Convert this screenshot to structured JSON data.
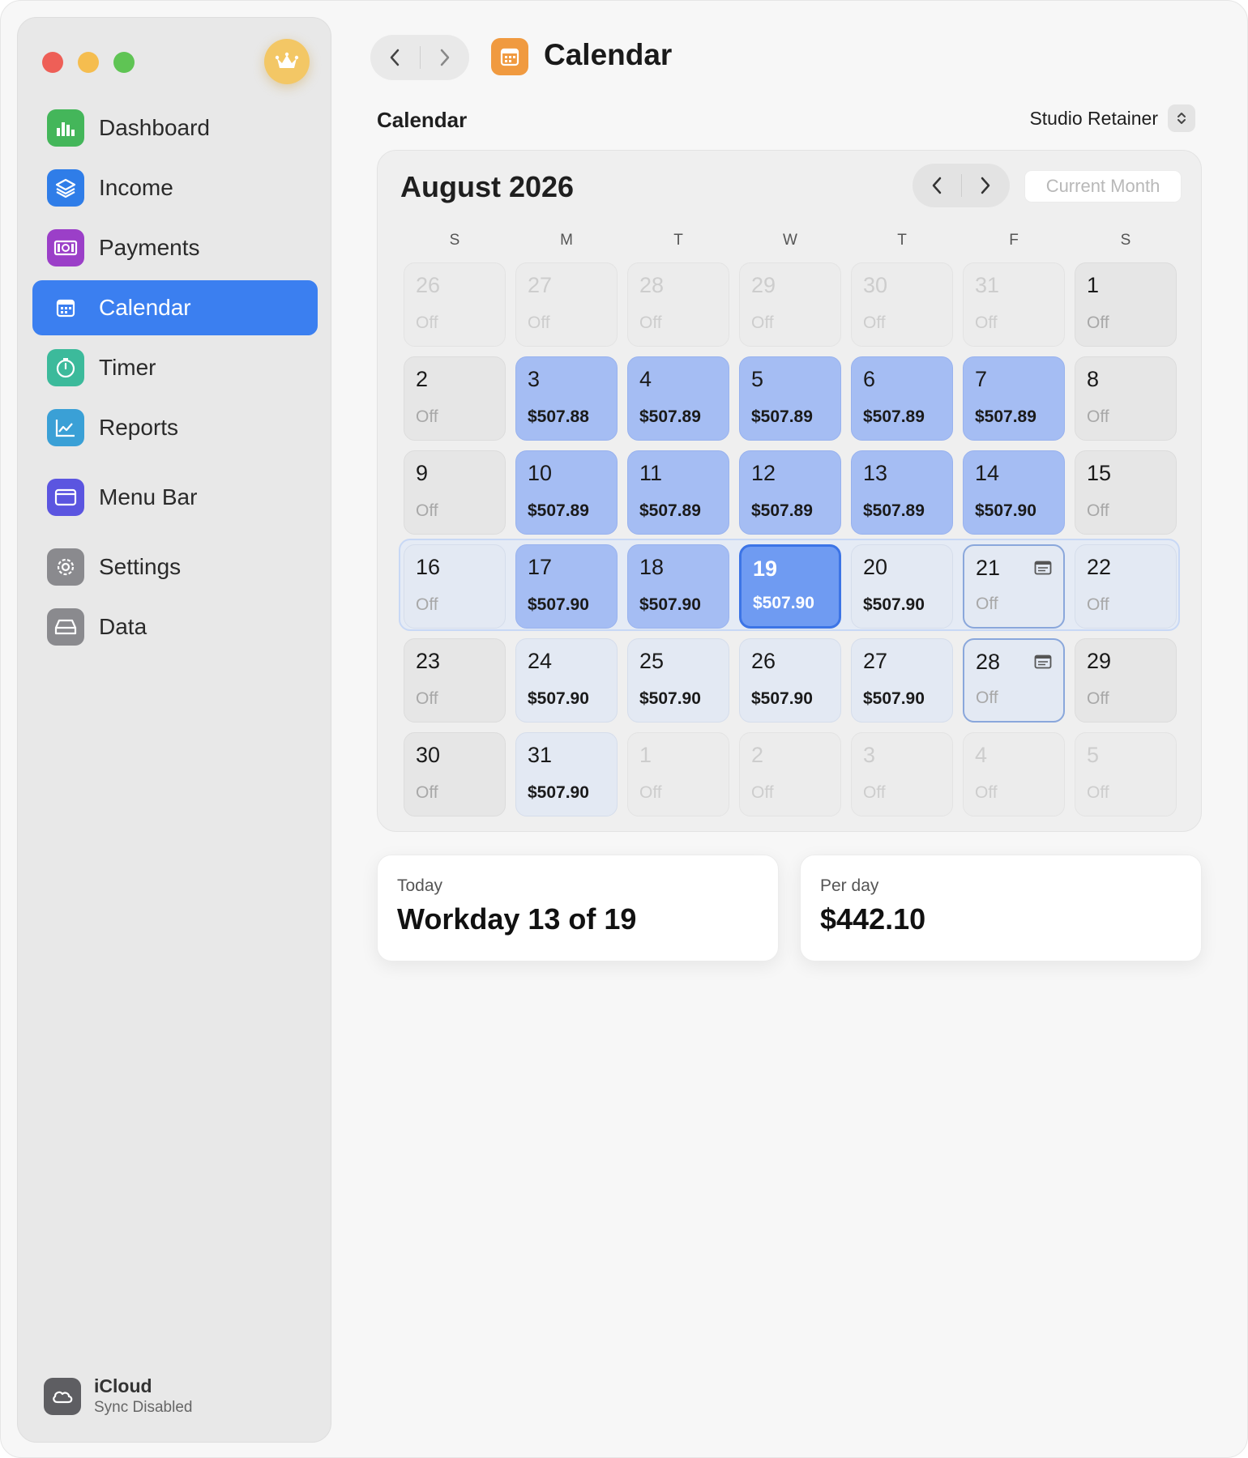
{
  "sidebar": {
    "items": [
      {
        "label": "Dashboard",
        "color": "#44b65a"
      },
      {
        "label": "Income",
        "color": "#2f7de8"
      },
      {
        "label": "Payments",
        "color": "#9b3fc8"
      },
      {
        "label": "Calendar",
        "color": "#3b7ff0"
      },
      {
        "label": "Timer",
        "color": "#3cba9b"
      },
      {
        "label": "Reports",
        "color": "#3aa0d6"
      },
      {
        "label": "Menu Bar",
        "color": "#5b55e0"
      },
      {
        "label": "Settings",
        "color": "#8a8a8e"
      },
      {
        "label": "Data",
        "color": "#8a8a8e"
      }
    ],
    "icloud": {
      "title": "iCloud",
      "status": "Sync Disabled"
    }
  },
  "header": {
    "title": "Calendar"
  },
  "section": {
    "title": "Calendar",
    "picker_value": "Studio Retainer"
  },
  "calendar": {
    "month_title": "August 2026",
    "current_month_button": "Current Month",
    "weekdays": [
      "S",
      "M",
      "T",
      "W",
      "T",
      "F",
      "S"
    ],
    "days": [
      {
        "day": "26",
        "amount": "Off",
        "state": "other"
      },
      {
        "day": "27",
        "amount": "Off",
        "state": "other"
      },
      {
        "day": "28",
        "amount": "Off",
        "state": "other"
      },
      {
        "day": "29",
        "amount": "Off",
        "state": "other"
      },
      {
        "day": "30",
        "amount": "Off",
        "state": "other"
      },
      {
        "day": "31",
        "amount": "Off",
        "state": "other"
      },
      {
        "day": "1",
        "amount": "Off",
        "state": "off"
      },
      {
        "day": "2",
        "amount": "Off",
        "state": "off"
      },
      {
        "day": "3",
        "amount": "$507.88",
        "state": "paid"
      },
      {
        "day": "4",
        "amount": "$507.89",
        "state": "paid"
      },
      {
        "day": "5",
        "amount": "$507.89",
        "state": "paid"
      },
      {
        "day": "6",
        "amount": "$507.89",
        "state": "paid"
      },
      {
        "day": "7",
        "amount": "$507.89",
        "state": "paid"
      },
      {
        "day": "8",
        "amount": "Off",
        "state": "off"
      },
      {
        "day": "9",
        "amount": "Off",
        "state": "off"
      },
      {
        "day": "10",
        "amount": "$507.89",
        "state": "paid"
      },
      {
        "day": "11",
        "amount": "$507.89",
        "state": "paid"
      },
      {
        "day": "12",
        "amount": "$507.89",
        "state": "paid"
      },
      {
        "day": "13",
        "amount": "$507.89",
        "state": "paid"
      },
      {
        "day": "14",
        "amount": "$507.90",
        "state": "paid"
      },
      {
        "day": "15",
        "amount": "Off",
        "state": "off"
      },
      {
        "day": "16",
        "amount": "Off",
        "state": "weekend-cur"
      },
      {
        "day": "17",
        "amount": "$507.90",
        "state": "paid"
      },
      {
        "day": "18",
        "amount": "$507.90",
        "state": "paid"
      },
      {
        "day": "19",
        "amount": "$507.90",
        "state": "today"
      },
      {
        "day": "20",
        "amount": "$507.90",
        "state": "future"
      },
      {
        "day": "21",
        "amount": "Off",
        "state": "outline",
        "note": true
      },
      {
        "day": "22",
        "amount": "Off",
        "state": "weekend-cur"
      },
      {
        "day": "23",
        "amount": "Off",
        "state": "off"
      },
      {
        "day": "24",
        "amount": "$507.90",
        "state": "future"
      },
      {
        "day": "25",
        "amount": "$507.90",
        "state": "future"
      },
      {
        "day": "26",
        "amount": "$507.90",
        "state": "future"
      },
      {
        "day": "27",
        "amount": "$507.90",
        "state": "future"
      },
      {
        "day": "28",
        "amount": "Off",
        "state": "outline",
        "note": true
      },
      {
        "day": "29",
        "amount": "Off",
        "state": "off"
      },
      {
        "day": "30",
        "amount": "Off",
        "state": "off"
      },
      {
        "day": "31",
        "amount": "$507.90",
        "state": "future"
      },
      {
        "day": "1",
        "amount": "Off",
        "state": "other"
      },
      {
        "day": "2",
        "amount": "Off",
        "state": "other"
      },
      {
        "day": "3",
        "amount": "Off",
        "state": "other"
      },
      {
        "day": "4",
        "amount": "Off",
        "state": "other"
      },
      {
        "day": "5",
        "amount": "Off",
        "state": "other"
      }
    ]
  },
  "stats": {
    "today_label": "Today",
    "today_value": "Workday 13 of 19",
    "perday_label": "Per day",
    "perday_value": "$442.10"
  }
}
